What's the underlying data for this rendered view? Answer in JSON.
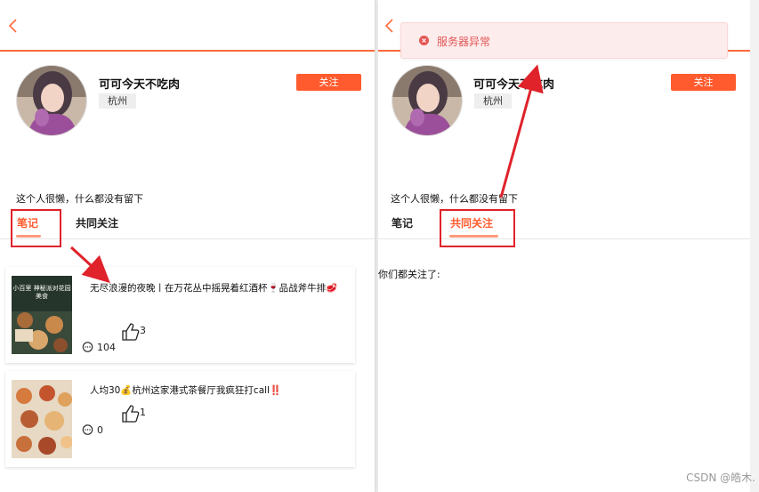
{
  "left": {
    "profile": {
      "name": "可可今天不吃肉",
      "city": "杭州",
      "follow_label": "关注",
      "bio": "这个人很懒，什么都没有留下"
    },
    "tabs": [
      {
        "label": "笔记",
        "active": true
      },
      {
        "label": "共同关注",
        "active": false
      }
    ],
    "notes": [
      {
        "title": "无尽浪漫的夜晚丨在万花丛中摇晃着红酒杯🍷品战斧牛排🥩",
        "likes": "3",
        "comments": "104",
        "thumb_text": "小百里 神秘派对花园美食"
      },
      {
        "title": "人均30💰杭州这家港式茶餐厅我疯狂打call‼️",
        "likes": "1",
        "comments": "0",
        "thumb_text": ""
      }
    ]
  },
  "right": {
    "profile": {
      "name": "可可今天不吃肉",
      "city": "杭州",
      "follow_label": "关注",
      "bio": "这个人很懒，什么都没有留下"
    },
    "tabs": [
      {
        "label": "笔记",
        "active": false
      },
      {
        "label": "共同关注",
        "active": true
      }
    ],
    "common_text": "你们都关注了:",
    "toast": {
      "message": "服务器异常",
      "type": "error"
    }
  },
  "watermark": "CSDN @皓木.",
  "colors": {
    "accent": "#ff5b2e",
    "annotation": "#e0222b",
    "toast_bg": "#fdecec",
    "toast_text": "#e45656"
  }
}
